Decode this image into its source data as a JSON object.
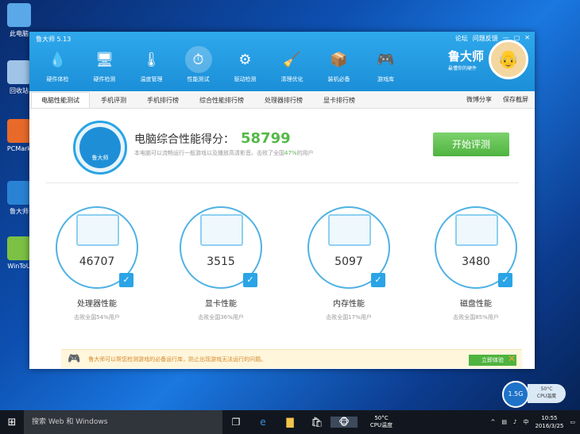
{
  "desktop": {
    "icons": [
      {
        "label": "此电脑",
        "color": "#5aa8e8"
      },
      {
        "label": "回收站",
        "color": "#a0c4e8"
      },
      {
        "label": "PCMark",
        "color": "#e86a2a"
      },
      {
        "label": "鲁大师",
        "color": "#2a82d4"
      },
      {
        "label": "WinToU",
        "color": "#7cc144"
      }
    ]
  },
  "window": {
    "title": "鲁大师 5.13",
    "controls": [
      "论坛",
      "问题反馈",
      "—",
      "▢",
      "✕"
    ]
  },
  "toolbar": {
    "tools": [
      {
        "label": "硬件体检",
        "icon": "💧"
      },
      {
        "label": "硬件检测",
        "icon": "🖥"
      },
      {
        "label": "温度管理",
        "icon": "🌡"
      },
      {
        "label": "性能测试",
        "icon": "⏱"
      },
      {
        "label": "驱动检测",
        "icon": "⚙"
      },
      {
        "label": "清理优化",
        "icon": "🧹"
      },
      {
        "label": "装机必备",
        "icon": "📦"
      },
      {
        "label": "游戏库",
        "icon": "🎮"
      }
    ]
  },
  "brand": {
    "name": "鲁大师",
    "slogan": "最懂你的硬件"
  },
  "tabs": [
    "电脑性能测试",
    "手机评测",
    "手机排行榜",
    "综合性能排行榜",
    "处理器排行榜",
    "显卡排行榜"
  ],
  "tab_right": {
    "weibo": "微博分享",
    "save": "保存截屏"
  },
  "score": {
    "dial": "鲁大师",
    "title": "电脑综合性能得分：",
    "value": "58799",
    "sub_before": "本电脑可以流畅运行一般游戏以及播放高清影音。击败了全国",
    "percent": "47%",
    "sub_after": "的用户",
    "button": "开始评测"
  },
  "cards": [
    {
      "value": "46707",
      "label": "处理器性能",
      "sub": "击败全国54%用户"
    },
    {
      "value": "3515",
      "label": "显卡性能",
      "sub": "击败全国36%用户"
    },
    {
      "value": "5097",
      "label": "内存性能",
      "sub": "击败全国17%用户"
    },
    {
      "value": "3480",
      "label": "磁盘性能",
      "sub": "击败全国85%用户"
    }
  ],
  "banner": {
    "text": "鲁大师可以帮您检测游戏的必备运行库，防止出现游戏无法运行的问题。",
    "button": "立即体验",
    "close": "✕"
  },
  "temp": {
    "bubble": "1.5G",
    "line1": "50°C",
    "line2": "CPU温度"
  },
  "taskbar": {
    "search": "搜索 Web 和 Windows",
    "temp1": "50°C",
    "temp2": "CPU温度",
    "time": "10:55",
    "date": "2016/3/25"
  }
}
